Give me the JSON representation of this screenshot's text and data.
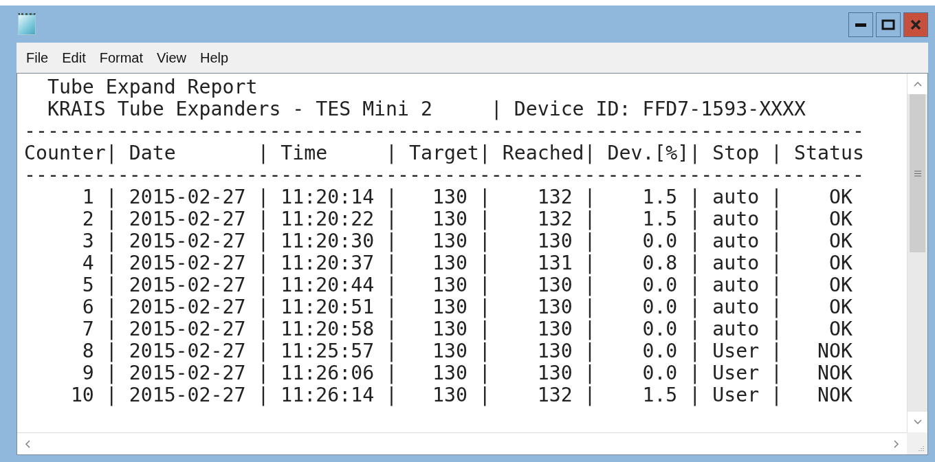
{
  "window": {
    "controls": [
      {
        "kind": "minimize"
      },
      {
        "kind": "maximize"
      },
      {
        "kind": "close"
      }
    ]
  },
  "menu": [
    "File",
    "Edit",
    "Format",
    "View",
    "Help"
  ],
  "document": {
    "lines": [
      "  Tube Expand Report",
      "  KRAIS Tube Expanders - TES Mini 2     | Device ID: FFD7-1593-XXXX",
      "------------------------------------------------------------------------",
      "Counter| Date       | Time     | Target| Reached| Dev.[%]| Stop | Status",
      "------------------------------------------------------------------------",
      "     1 | 2015-02-27 | 11:20:14 |   130 |    132 |    1.5 | auto |    OK",
      "     2 | 2015-02-27 | 11:20:22 |   130 |    132 |    1.5 | auto |    OK",
      "     3 | 2015-02-27 | 11:20:30 |   130 |    130 |    0.0 | auto |    OK",
      "     4 | 2015-02-27 | 11:20:37 |   130 |    131 |    0.8 | auto |    OK",
      "     5 | 2015-02-27 | 11:20:44 |   130 |    130 |    0.0 | auto |    OK",
      "     6 | 2015-02-27 | 11:20:51 |   130 |    130 |    0.0 | auto |    OK",
      "     7 | 2015-02-27 | 11:20:58 |   130 |    130 |    0.0 | auto |    OK",
      "     8 | 2015-02-27 | 11:25:57 |   130 |    130 |    0.0 | User |   NOK",
      "     9 | 2015-02-27 | 11:26:06 |   130 |    130 |    0.0 | User |   NOK",
      "    10 | 2015-02-27 | 11:26:14 |   130 |    132 |    1.5 | User |   NOK"
    ]
  }
}
